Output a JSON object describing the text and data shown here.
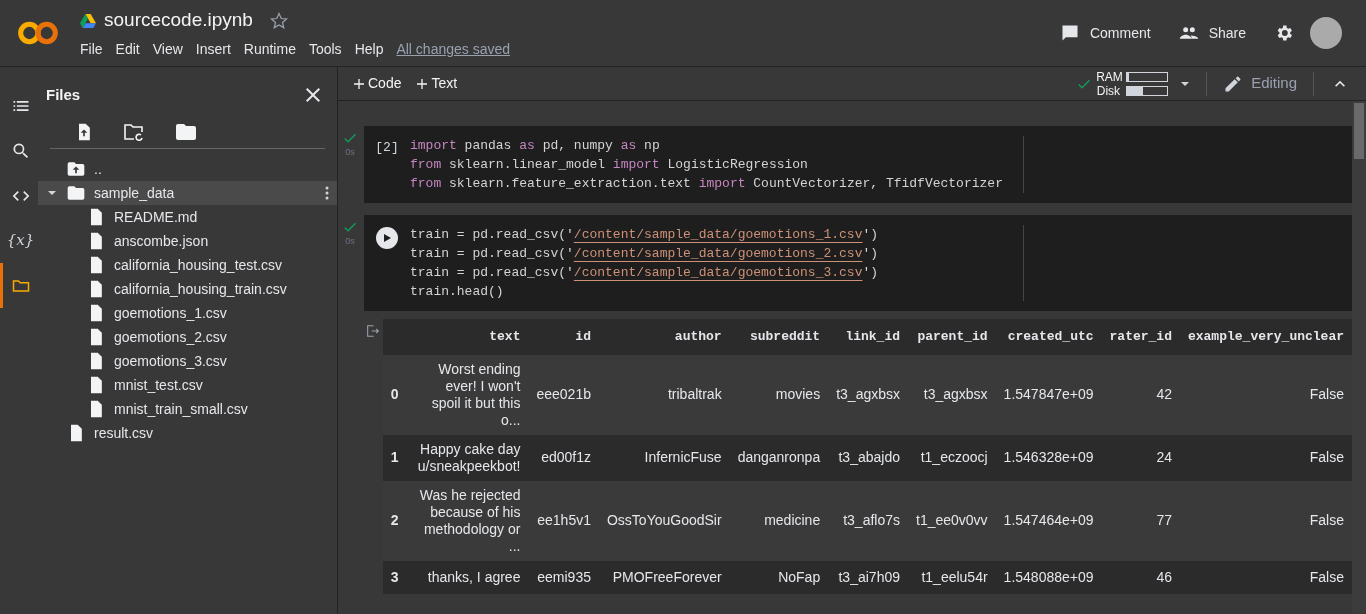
{
  "notebook": {
    "title": "sourcecode.ipynb",
    "starred": false,
    "menu": [
      "File",
      "Edit",
      "View",
      "Insert",
      "Runtime",
      "Tools",
      "Help"
    ],
    "save_status": "All changes saved"
  },
  "header_actions": [
    {
      "kind": "comment",
      "label": "Comment"
    },
    {
      "kind": "share",
      "label": "Share"
    }
  ],
  "rail": [
    {
      "kind": "menu",
      "selected": false
    },
    {
      "kind": "search",
      "selected": false
    },
    {
      "kind": "code",
      "selected": false
    },
    {
      "kind": "variables",
      "glyph": "{x}",
      "selected": false
    },
    {
      "kind": "files",
      "selected": true
    }
  ],
  "files_panel": {
    "title": "Files",
    "tree": [
      {
        "kind": "parent",
        "name": "..",
        "selected": false
      },
      {
        "kind": "folder",
        "name": "sample_data",
        "selected": true,
        "expanded": true,
        "children": [
          {
            "kind": "file",
            "name": "README.md",
            "selected": false
          },
          {
            "kind": "file",
            "name": "anscombe.json",
            "selected": false
          },
          {
            "kind": "file",
            "name": "california_housing_test.csv",
            "selected": false
          },
          {
            "kind": "file",
            "name": "california_housing_train.csv",
            "selected": false
          },
          {
            "kind": "file",
            "name": "goemotions_1.csv",
            "selected": false
          },
          {
            "kind": "file",
            "name": "goemotions_2.csv",
            "selected": false
          },
          {
            "kind": "file",
            "name": "goemotions_3.csv",
            "selected": false
          },
          {
            "kind": "file",
            "name": "mnist_test.csv",
            "selected": false
          },
          {
            "kind": "file",
            "name": "mnist_train_small.csv",
            "selected": false
          }
        ]
      },
      {
        "kind": "file",
        "name": "result.csv",
        "selected": false
      }
    ]
  },
  "toolbar": {
    "add": [
      "Code",
      "Text"
    ],
    "ram": {
      "label": "RAM",
      "level": 0.05
    },
    "disk": {
      "label": "Disk",
      "level": 0.4
    },
    "connected": true,
    "mode": "Editing"
  },
  "cells": [
    {
      "kind": "executed",
      "count": "[2]",
      "time": "0s",
      "done": true,
      "lines": [
        [
          {
            "text": "import",
            "kind": "keyword"
          },
          {
            "text": " pandas ",
            "kind": "plain"
          },
          {
            "text": "as",
            "kind": "keyword"
          },
          {
            "text": " pd, numpy ",
            "kind": "plain"
          },
          {
            "text": "as",
            "kind": "keyword"
          },
          {
            "text": " np",
            "kind": "plain"
          }
        ],
        [
          {
            "text": "from",
            "kind": "keyword"
          },
          {
            "text": " sklearn.linear_model ",
            "kind": "plain"
          },
          {
            "text": "import",
            "kind": "keyword"
          },
          {
            "text": " LogisticRegression",
            "kind": "plain"
          }
        ],
        [
          {
            "text": "from",
            "kind": "keyword"
          },
          {
            "text": " sklearn.feature_extraction.text ",
            "kind": "plain"
          },
          {
            "text": "import",
            "kind": "keyword"
          },
          {
            "text": " CountVectorizer, TfidfVectorizer",
            "kind": "plain"
          }
        ]
      ]
    },
    {
      "kind": "runnable",
      "time": "0s",
      "done": true,
      "lines": [
        [
          {
            "text": "train = pd.read_csv('",
            "kind": "plain"
          },
          {
            "text": "/content/sample_data/goemotions_1.csv",
            "kind": "string"
          },
          {
            "text": "')",
            "kind": "plain"
          }
        ],
        [
          {
            "text": "train = pd.read_csv('",
            "kind": "plain"
          },
          {
            "text": "/content/sample_data/goemotions_2.csv",
            "kind": "string"
          },
          {
            "text": "')",
            "kind": "plain"
          }
        ],
        [
          {
            "text": "train = pd.read_csv('",
            "kind": "plain"
          },
          {
            "text": "/content/sample_data/goemotions_3.csv",
            "kind": "string"
          },
          {
            "text": "')",
            "kind": "plain"
          }
        ],
        [
          {
            "text": "train.head()",
            "kind": "plain"
          }
        ]
      ],
      "output": {
        "columns": [
          "text",
          "id",
          "author",
          "subreddit",
          "link_id",
          "parent_id",
          "created_utc",
          "rater_id",
          "example_very_unclear"
        ],
        "rows": [
          {
            "index": "0",
            "cells": [
              "Worst ending ever! I won't spoil it but this o...",
              "eee021b",
              "tribaltrak",
              "movies",
              "t3_agxbsx",
              "t3_agxbsx",
              "1.547847e+09",
              "42",
              "False"
            ]
          },
          {
            "index": "1",
            "cells": [
              "Happy cake day u/sneakpeekbot!",
              "ed00f1z",
              "InfernicFuse",
              "danganronpa",
              "t3_abajdo",
              "t1_eczoocj",
              "1.546328e+09",
              "24",
              "False"
            ]
          },
          {
            "index": "2",
            "cells": [
              "Was he rejected because of his methodology or ...",
              "ee1h5v1",
              "OssToYouGoodSir",
              "medicine",
              "t3_aflo7s",
              "t1_ee0v0vv",
              "1.547464e+09",
              "77",
              "False"
            ]
          },
          {
            "index": "3",
            "cells": [
              "thanks, I agree",
              "eemi935",
              "PMOFreeForever",
              "NoFap",
              "t3_ai7h09",
              "t1_eelu54r",
              "1.548088e+09",
              "46",
              "False"
            ]
          }
        ]
      }
    }
  ]
}
